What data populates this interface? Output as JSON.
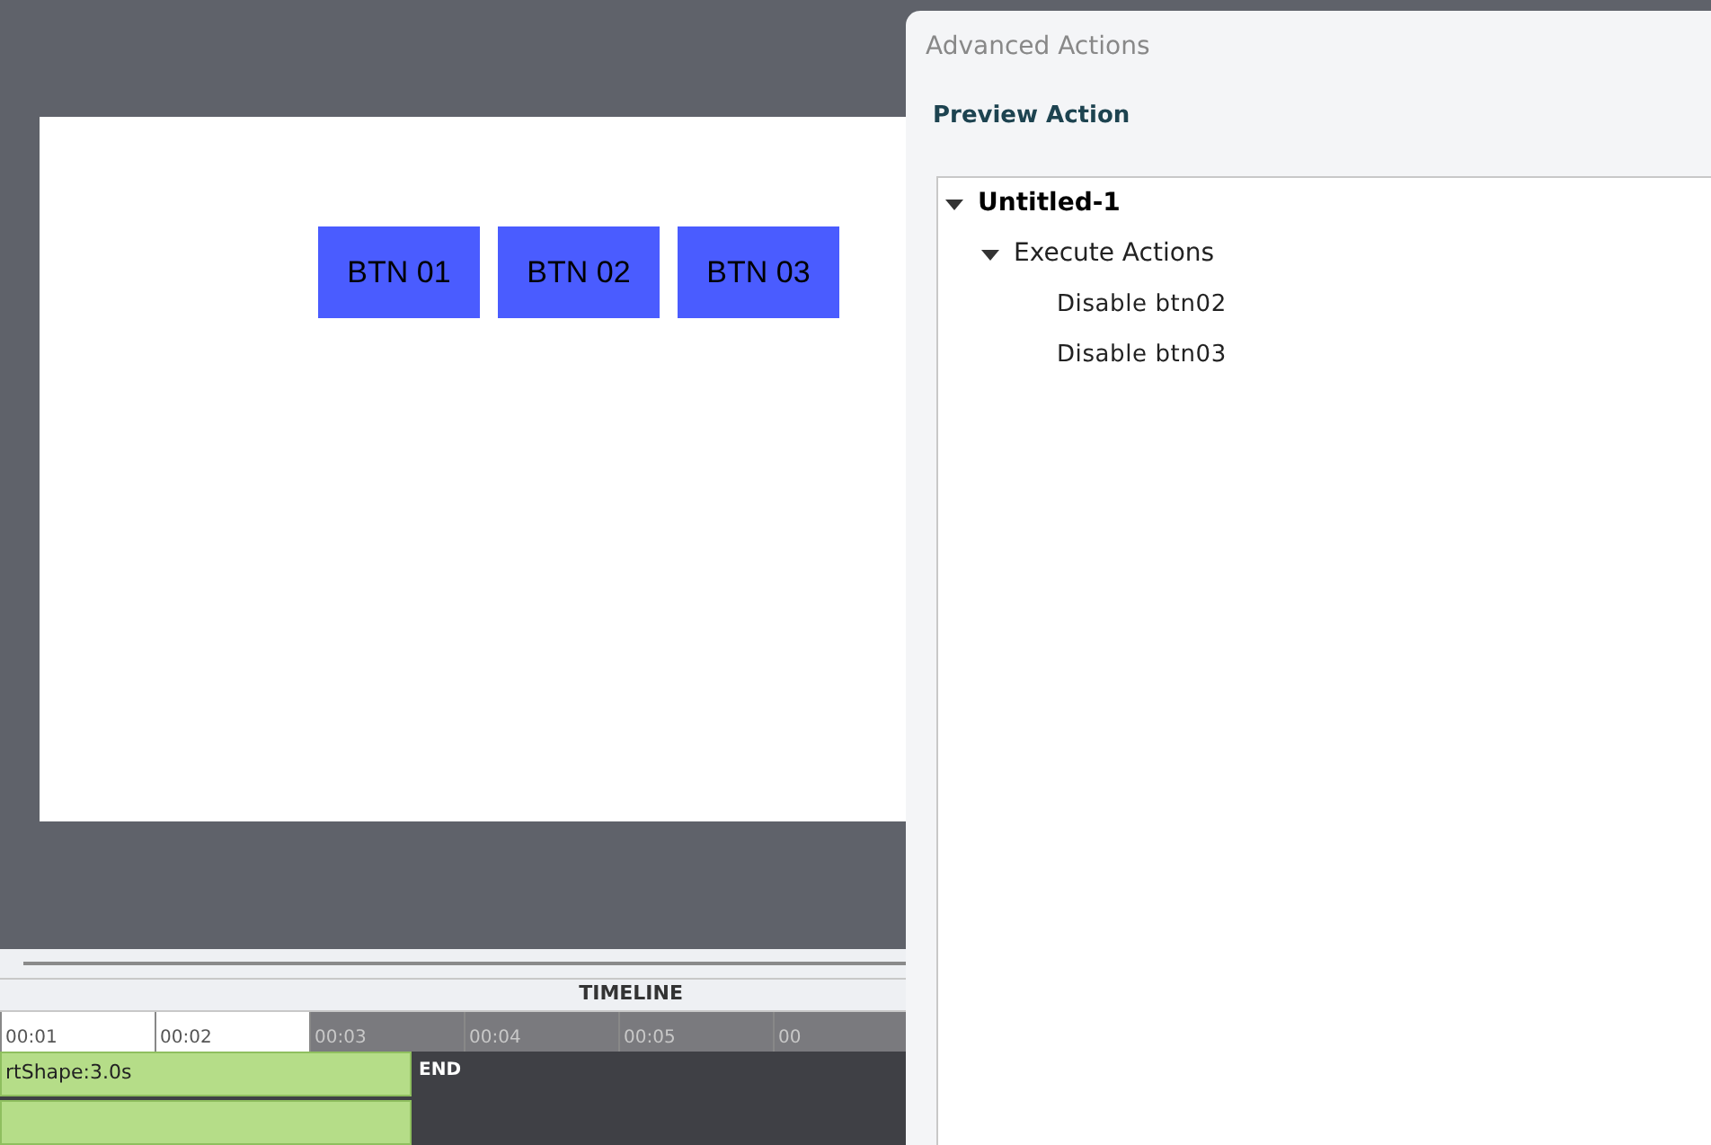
{
  "stage": {
    "buttons": [
      {
        "label": "BTN 01"
      },
      {
        "label": "BTN 02"
      },
      {
        "label": "BTN 03"
      }
    ]
  },
  "timeline": {
    "title": "TIMELINE",
    "ticks": [
      {
        "label": "00:01",
        "past_end": false
      },
      {
        "label": "00:02",
        "past_end": false
      },
      {
        "label": "00:03",
        "past_end": true
      },
      {
        "label": "00:04",
        "past_end": true
      },
      {
        "label": "00:05",
        "past_end": true
      },
      {
        "label": "00",
        "past_end": true
      }
    ],
    "tracks": [
      {
        "kind": "labeled",
        "label": "rtShape:3.0s"
      },
      {
        "kind": "plain"
      }
    ],
    "end_label": "END"
  },
  "dialog": {
    "title": "Advanced Actions",
    "section": "Preview Action",
    "tree": [
      {
        "label": "Untitled-1",
        "bold": true,
        "expanded": true,
        "children": [
          {
            "label": "Execute Actions",
            "bold": false,
            "expanded": true,
            "children": [
              {
                "label": "Disable btn02",
                "bold": false
              },
              {
                "label": "Disable btn03",
                "bold": false
              }
            ]
          }
        ]
      }
    ]
  }
}
